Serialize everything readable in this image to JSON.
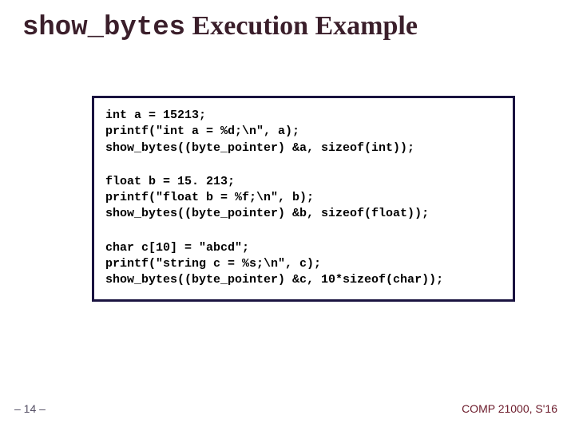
{
  "title": {
    "mono": "show_bytes",
    "rest": " Execution Example"
  },
  "code": {
    "block1": "int a = 15213;\nprintf(\"int a = %d;\\n\", a);\nshow_bytes((byte_pointer) &a, sizeof(int));",
    "block2": "float b = 15. 213;\nprintf(\"float b = %f;\\n\", b);\nshow_bytes((byte_pointer) &b, sizeof(float));",
    "block3": "char c[10] = \"abcd\";\nprintf(\"string c = %s;\\n\", c);\nshow_bytes((byte_pointer) &c, 10*sizeof(char));"
  },
  "footer": {
    "left": "– 14 –",
    "right": "COMP 21000, S'16"
  }
}
